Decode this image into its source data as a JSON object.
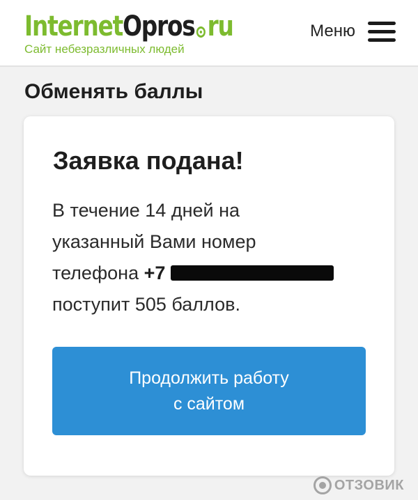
{
  "header": {
    "logo": {
      "part1": "Internet",
      "part2": "Opros",
      "part3": "ru"
    },
    "tagline": "Сайт небезразличных людей",
    "menu_label": "Меню"
  },
  "page_title": "Обменять баллы",
  "card": {
    "title": "Заявка подана!",
    "text_line1": "В течение 14 дней на",
    "text_line2": "указанный Вами номер",
    "text_line3_prefix": "телефона ",
    "phone_prefix": "+7",
    "text_line4": "поступит 505 баллов.",
    "button_line1": "Продолжить работу",
    "button_line2": "с сайтом"
  },
  "watermark": "ОТЗОВИК",
  "colors": {
    "brand_green": "#7dbb2f",
    "button_blue": "#2d8fd5",
    "background": "#f2f2f2"
  }
}
